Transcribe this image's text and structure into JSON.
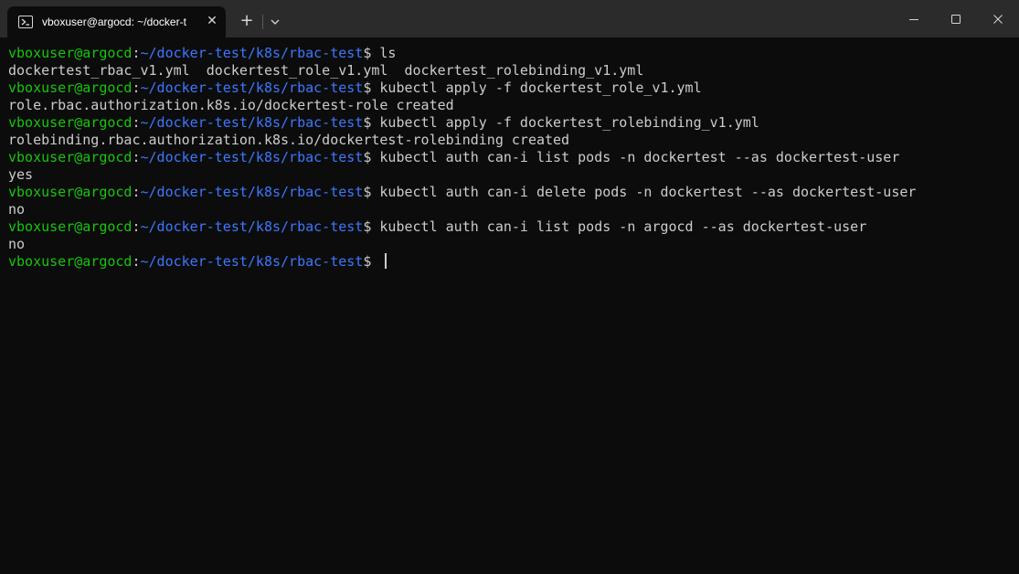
{
  "window": {
    "tab_title": "vboxuser@argocd: ~/docker-t",
    "tab_close_glyph": "✕",
    "new_tab_glyph": "+",
    "tab_icon": "powershell-terminal-icon",
    "controls": [
      "minimize-icon",
      "maximize-icon",
      "close-icon"
    ]
  },
  "colors": {
    "background": "#0c0c0c",
    "titlebar": "#2b2b2b",
    "prompt_user": "#16c60c",
    "prompt_path": "#3b78ff",
    "text": "#cccccc"
  },
  "terminal": {
    "lines": [
      {
        "type": "prompt",
        "user": "vboxuser@argocd",
        "sep": ":",
        "path": "~/docker-test/k8s/rbac-test",
        "dollar": "$",
        "cmd": " ls"
      },
      {
        "type": "output",
        "text": "dockertest_rbac_v1.yml  dockertest_role_v1.yml  dockertest_rolebinding_v1.yml"
      },
      {
        "type": "prompt",
        "user": "vboxuser@argocd",
        "sep": ":",
        "path": "~/docker-test/k8s/rbac-test",
        "dollar": "$",
        "cmd": " kubectl apply -f dockertest_role_v1.yml"
      },
      {
        "type": "output",
        "text": "role.rbac.authorization.k8s.io/dockertest-role created"
      },
      {
        "type": "prompt",
        "user": "vboxuser@argocd",
        "sep": ":",
        "path": "~/docker-test/k8s/rbac-test",
        "dollar": "$",
        "cmd": " kubectl apply -f dockertest_rolebinding_v1.yml"
      },
      {
        "type": "output",
        "text": "rolebinding.rbac.authorization.k8s.io/dockertest-rolebinding created"
      },
      {
        "type": "prompt",
        "user": "vboxuser@argocd",
        "sep": ":",
        "path": "~/docker-test/k8s/rbac-test",
        "dollar": "$",
        "cmd": " kubectl auth can-i list pods -n dockertest --as dockertest-user"
      },
      {
        "type": "output",
        "text": "yes"
      },
      {
        "type": "prompt",
        "user": "vboxuser@argocd",
        "sep": ":",
        "path": "~/docker-test/k8s/rbac-test",
        "dollar": "$",
        "cmd": " kubectl auth can-i delete pods -n dockertest --as dockertest-user"
      },
      {
        "type": "output",
        "text": "no"
      },
      {
        "type": "prompt",
        "user": "vboxuser@argocd",
        "sep": ":",
        "path": "~/docker-test/k8s/rbac-test",
        "dollar": "$",
        "cmd": " kubectl auth can-i list pods -n argocd --as dockertest-user"
      },
      {
        "type": "output",
        "text": "no"
      },
      {
        "type": "prompt",
        "user": "vboxuser@argocd",
        "sep": ":",
        "path": "~/docker-test/k8s/rbac-test",
        "dollar": "$",
        "cmd": " ",
        "cursor": true
      }
    ]
  }
}
